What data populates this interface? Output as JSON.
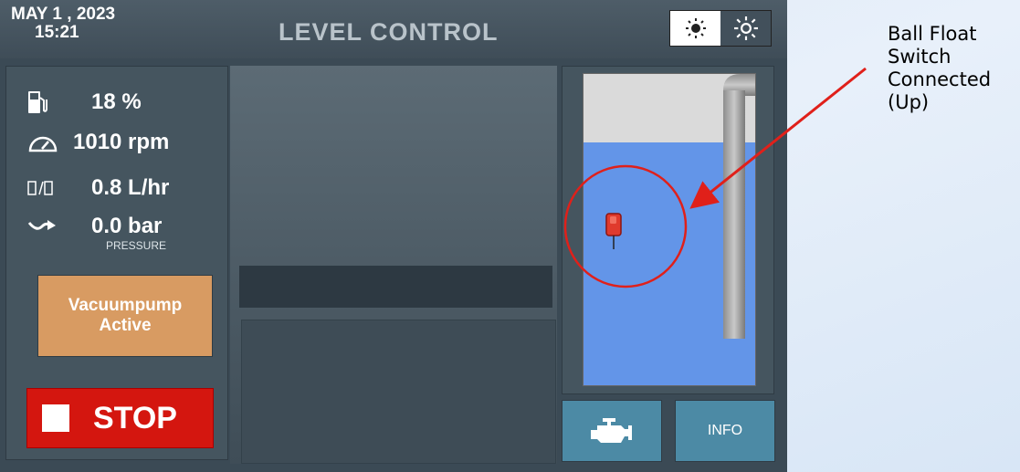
{
  "header": {
    "date": "MAY  1 , 2023",
    "time": "15:21",
    "title": "LEVEL CONTROL",
    "brightness_icons": [
      "sun-low-icon",
      "sun-high-icon"
    ]
  },
  "stats": {
    "fuel": {
      "icon": "fuel-icon",
      "value": "18 %"
    },
    "speed": {
      "icon": "gauge-icon",
      "value": "1010 rpm"
    },
    "consumption": {
      "icon": "fuel-flow-icon",
      "value": "0.8 L/hr"
    },
    "pressure": {
      "icon": "pressure-arrow-icon",
      "value": "0.0 bar",
      "label": "PRESSURE"
    }
  },
  "buttons": {
    "vacuum_line1": "Vacuumpump",
    "vacuum_line2": "Active",
    "stop": "STOP",
    "engine_icon": "engine-icon",
    "info": "INFO"
  },
  "tank": {
    "water_level_fraction": 0.78
  },
  "annotation": {
    "line1": "Ball Float",
    "line2": "Switch",
    "line3": "Connected",
    "line4": "(Up)",
    "color": "#e0201a"
  },
  "colors": {
    "background": "#3b4a55",
    "vacuum_button": "#d89b62",
    "stop_button": "#d4160f",
    "water": "#6395e8",
    "action_button": "#4c8aa5"
  }
}
